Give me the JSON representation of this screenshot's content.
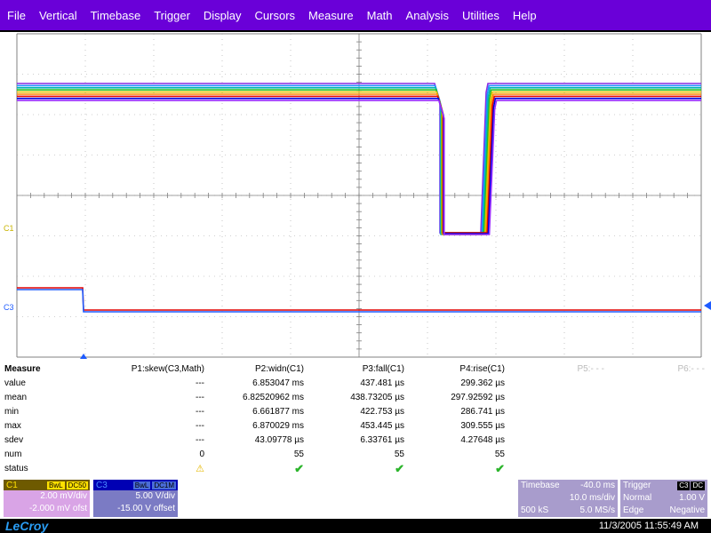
{
  "menu": [
    "File",
    "Vertical",
    "Timebase",
    "Trigger",
    "Display",
    "Cursors",
    "Measure",
    "Math",
    "Analysis",
    "Utilities",
    "Help"
  ],
  "channel_labels": {
    "c1": "C1",
    "c3": "C3"
  },
  "colors": {
    "menu_bg": "#6a00d8",
    "c1": "#c8b400",
    "c3": "#1e5bff",
    "c1_panel": "#d9a4e6",
    "c3_panel": "#7b7bc4",
    "timebase_panel": "#a89ccc",
    "trigger_panel": "#a89ccc"
  },
  "measure": {
    "title": "Measure",
    "params": [
      "P1:skew(C3,Math)",
      "P2:widn(C1)",
      "P3:fall(C1)",
      "P4:rise(C1)",
      "P5:- - -",
      "P6:- - -"
    ],
    "rows": [
      {
        "label": "value",
        "cells": [
          "---",
          "6.853047 ms",
          "437.481 µs",
          "299.362 µs"
        ]
      },
      {
        "label": "mean",
        "cells": [
          "---",
          "6.82520962 ms",
          "438.73205 µs",
          "297.92592 µs"
        ]
      },
      {
        "label": "min",
        "cells": [
          "---",
          "6.661877 ms",
          "422.753 µs",
          "286.741 µs"
        ]
      },
      {
        "label": "max",
        "cells": [
          "---",
          "6.870029 ms",
          "453.445 µs",
          "309.555 µs"
        ]
      },
      {
        "label": "sdev",
        "cells": [
          "---",
          "43.09778 µs",
          "6.33761 µs",
          "4.27648 µs"
        ]
      },
      {
        "label": "num",
        "cells": [
          "0",
          "55",
          "55",
          "55"
        ]
      },
      {
        "label": "status",
        "cells": [
          "warn",
          "ok",
          "ok",
          "ok"
        ]
      }
    ]
  },
  "c1_panel": {
    "name": "C1",
    "tags": [
      "BwL",
      "DC50"
    ],
    "vdiv": "2.00 mV/div",
    "offset": "-2.000 mV ofst"
  },
  "c3_panel": {
    "name": "C3",
    "tags": [
      "BwL",
      "DC1M"
    ],
    "vdiv": "5.00 V/div",
    "offset": "-15.00 V offset"
  },
  "timebase": {
    "title": "Timebase",
    "delay": "-40.0 ms",
    "tdiv": "10.0 ms/div",
    "samples": "500 kS",
    "rate": "5.0 MS/s"
  },
  "trigger": {
    "title": "Trigger",
    "source": "C3",
    "coupling": "DC",
    "mode": "Normal",
    "level": "1.00 V",
    "type": "Edge",
    "slope": "Negative"
  },
  "footer": {
    "brand": "LeCroy",
    "datetime": "11/3/2005 11:55:49 AM"
  }
}
